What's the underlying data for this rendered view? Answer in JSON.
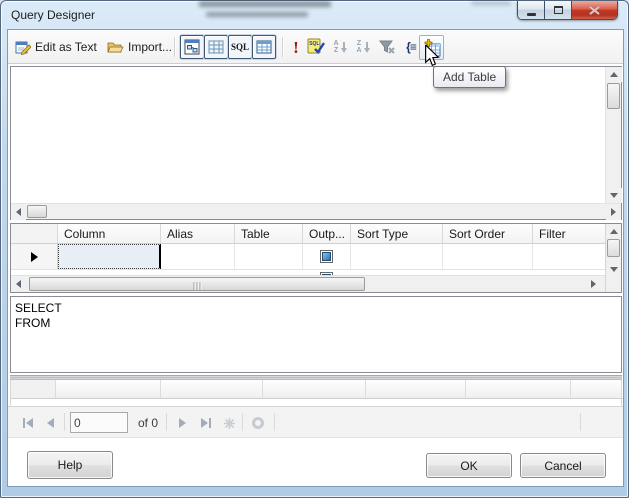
{
  "window": {
    "title": "Query Designer"
  },
  "toolbar": {
    "edit_as_text_label": "Edit as Text",
    "import_label": "Import...",
    "sql_pane_button_label": "SQL",
    "verify_sql_label": "SQL",
    "sort_ascending": {
      "top_letter": "A",
      "bottom_letter": "Z"
    },
    "sort_descending": {
      "top_letter": "Z",
      "bottom_letter": "A"
    },
    "group_by_glyph": "{≡"
  },
  "tooltip": {
    "text": "Add Table"
  },
  "criteria_grid": {
    "columns": [
      "Column",
      "Alias",
      "Table",
      "Outp...",
      "Sort Type",
      "Sort Order",
      "Filter"
    ],
    "row_output_checked": true
  },
  "sql_pane": {
    "lines": [
      "SELECT",
      "FROM"
    ]
  },
  "record_navigator": {
    "current": "0",
    "of_label": "of 0"
  },
  "footer": {
    "help": "Help",
    "ok": "OK",
    "cancel": "Cancel"
  },
  "colors": {
    "close_button": "#c23a26",
    "selection": "#e8eef5",
    "checkbox_fill": "#2e6da4",
    "accent_border": "#7f9db9"
  }
}
